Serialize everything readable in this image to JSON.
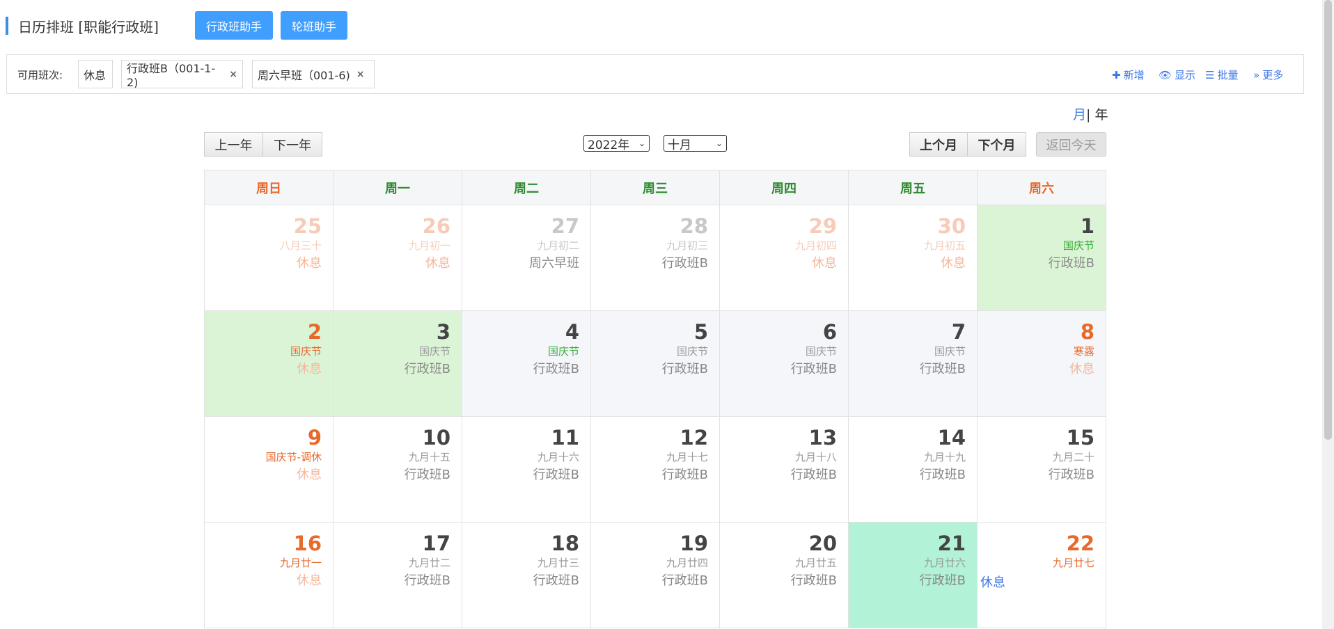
{
  "header": {
    "title": "日历排班 [职能行政班]",
    "btn_admin_helper": "行政班助手",
    "btn_rotate_helper": "轮班助手"
  },
  "shift_bar": {
    "label": "可用班次:",
    "chips": [
      "休息",
      "行政班B（001-1-2)",
      "周六早班（001-6)"
    ],
    "remove_glyph": "×",
    "actions": {
      "add": "新增",
      "show": "显示",
      "batch": "批量",
      "more": "更多"
    }
  },
  "view_switch": {
    "month": "月",
    "separator": "| ",
    "year": "年"
  },
  "nav": {
    "prev_year": "上一年",
    "next_year": "下一年",
    "year_select": "2022年",
    "month_select": "十月",
    "prev_month": "上个月",
    "next_month": "下个月",
    "today": "返回今天"
  },
  "weekdays": [
    "周日",
    "周一",
    "周二",
    "周三",
    "周四",
    "周五",
    "周六"
  ],
  "colors": {
    "primary": "#409eff",
    "link": "#3b78e7",
    "weekday_green": "#2e8b2e",
    "weekend_orange": "#e8692c",
    "holiday_bg": "#dcf4d6",
    "today_bg": "#b2f2d6"
  },
  "weeks": [
    [
      {
        "day": "25",
        "lunar": "八月三十",
        "shift": "休息"
      },
      {
        "day": "26",
        "lunar": "九月初一",
        "shift": "休息"
      },
      {
        "day": "27",
        "lunar": "九月初二",
        "shift": "周六早班"
      },
      {
        "day": "28",
        "lunar": "九月初三",
        "shift": "行政班B"
      },
      {
        "day": "29",
        "lunar": "九月初四",
        "shift": "休息"
      },
      {
        "day": "30",
        "lunar": "九月初五",
        "shift": "休息"
      },
      {
        "day": "1",
        "lunar": "国庆节",
        "shift": "行政班B"
      }
    ],
    [
      {
        "day": "2",
        "lunar": "国庆节",
        "shift": "休息"
      },
      {
        "day": "3",
        "lunar": "国庆节",
        "shift": "行政班B"
      },
      {
        "day": "4",
        "lunar": "国庆节",
        "shift": "行政班B"
      },
      {
        "day": "5",
        "lunar": "国庆节",
        "shift": "行政班B"
      },
      {
        "day": "6",
        "lunar": "国庆节",
        "shift": "行政班B"
      },
      {
        "day": "7",
        "lunar": "国庆节",
        "shift": "行政班B"
      },
      {
        "day": "8",
        "lunar": "寒露",
        "shift": "休息"
      }
    ],
    [
      {
        "day": "9",
        "lunar": "国庆节-调休",
        "shift": "休息"
      },
      {
        "day": "10",
        "lunar": "九月十五",
        "shift": "行政班B"
      },
      {
        "day": "11",
        "lunar": "九月十六",
        "shift": "行政班B"
      },
      {
        "day": "12",
        "lunar": "九月十七",
        "shift": "行政班B"
      },
      {
        "day": "13",
        "lunar": "九月十八",
        "shift": "行政班B"
      },
      {
        "day": "14",
        "lunar": "九月十九",
        "shift": "行政班B"
      },
      {
        "day": "15",
        "lunar": "九月二十",
        "shift": "行政班B"
      }
    ],
    [
      {
        "day": "16",
        "lunar": "九月廿一",
        "shift": "休息"
      },
      {
        "day": "17",
        "lunar": "九月廿二",
        "shift": "行政班B"
      },
      {
        "day": "18",
        "lunar": "九月廿三",
        "shift": "行政班B"
      },
      {
        "day": "19",
        "lunar": "九月廿四",
        "shift": "行政班B"
      },
      {
        "day": "20",
        "lunar": "九月廿五",
        "shift": "行政班B"
      },
      {
        "day": "21",
        "lunar": "九月廿六",
        "shift": "行政班B"
      },
      {
        "day": "22",
        "lunar": "九月廿七",
        "shift": "",
        "rest_left": "休息"
      }
    ]
  ]
}
